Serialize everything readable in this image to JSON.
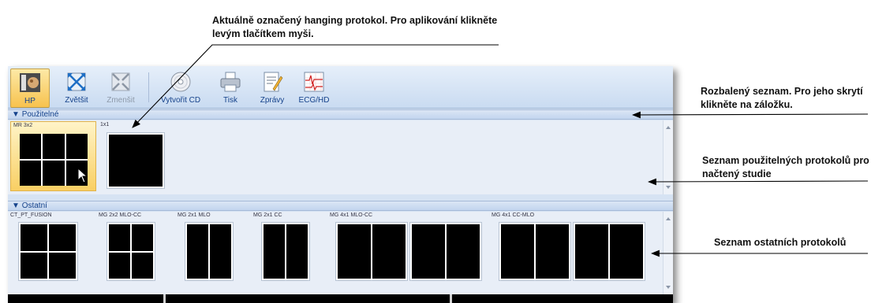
{
  "callouts": {
    "top": "Aktuálně označený hanging protokol. Pro aplikování klikněte levým tlačítkem myši.",
    "rollup": "Rozbalený seznam. Pro jeho skrytí klikněte na záložku.",
    "usable": "Seznam použitelných protokolů pro načtený studie",
    "other": "Seznam ostatních protokolů"
  },
  "ribbon": {
    "buttons": [
      {
        "label": "HP",
        "icon": "hanging-protocol-icon",
        "state": "active"
      },
      {
        "label": "Zvětšit",
        "icon": "maximize-icon",
        "state": "enabled"
      },
      {
        "label": "Zmenšit",
        "icon": "minimize-icon",
        "state": "disabled"
      },
      {
        "label": "Vytvořit CD",
        "icon": "cd-icon",
        "state": "enabled"
      },
      {
        "label": "Tisk",
        "icon": "printer-icon",
        "state": "enabled"
      },
      {
        "label": "Zprávy",
        "icon": "report-icon",
        "state": "enabled"
      },
      {
        "label": "ECG/HD",
        "icon": "ecg-icon",
        "state": "enabled"
      }
    ]
  },
  "sections": {
    "usable": {
      "title": "Použitelné",
      "protocols": [
        {
          "name": "MR 3x2",
          "cols": 3,
          "rows": 2,
          "frames": 1,
          "selected": true
        },
        {
          "name": "1x1",
          "cols": 1,
          "rows": 1,
          "frames": 1,
          "selected": false
        }
      ]
    },
    "other": {
      "title": "Ostatní",
      "protocols": [
        {
          "name": "CT_PT_FUSION",
          "cols": 2,
          "rows": 2,
          "frames": 1
        },
        {
          "name": "MG 2x2 MLO-CC",
          "cols": 2,
          "rows": 2,
          "frames": 1
        },
        {
          "name": "MG 2x1 MLO",
          "cols": 2,
          "rows": 1,
          "frames": 1
        },
        {
          "name": "MG 2x1 CC",
          "cols": 2,
          "rows": 1,
          "frames": 1
        },
        {
          "name": "MG 4x1 MLO-CC",
          "cols": 2,
          "rows": 1,
          "frames": 2
        },
        {
          "name": "MG 4x1 CC-MLO",
          "cols": 2,
          "rows": 1,
          "frames": 2
        }
      ]
    }
  },
  "colors": {
    "ribbon": "#c9dbf1",
    "header_text": "#15428b",
    "selected": "#f7c24e",
    "cell": "#000000"
  }
}
